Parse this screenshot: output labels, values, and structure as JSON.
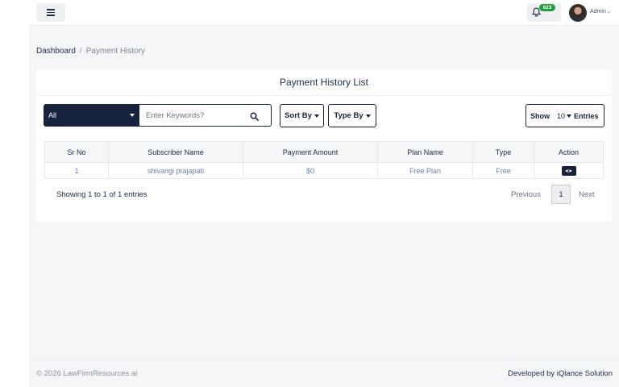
{
  "topbar": {
    "notification_count": "623",
    "user_name": "Admin"
  },
  "breadcrumb": {
    "home": "Dashboard",
    "separator": "/",
    "current": "Payment History"
  },
  "card": {
    "title": "Payment History List"
  },
  "filters": {
    "category_value": "All",
    "search_placeholder": "Enter Keywords?",
    "search_value": "",
    "sort_label": "Sort By",
    "type_label": "Type By",
    "show_label": "Show",
    "entries_value": "10",
    "entries_label": "Entries"
  },
  "table": {
    "columns": [
      "Sr No",
      "Subscriber Name",
      "Payment Amount",
      "Plan Name",
      "Type",
      "Action"
    ],
    "rows": [
      {
        "sr_no": "1",
        "subscriber_name": "shivangi prajapati",
        "payment_amount": "$0",
        "plan_name": "Free Plan",
        "type": "Free"
      }
    ]
  },
  "pagination": {
    "summary": "Showing 1 to 1 of 1 entries",
    "previous": "Previous",
    "current_page": "1",
    "next": "Next"
  },
  "footer": {
    "copyright": "© 2026 LawFirmResources.ai",
    "credit": "Developed by iQlance Solution"
  },
  "colors": {
    "primary_dark": "#17223d",
    "badge_green": "#1f9d3a",
    "page_bg": "#f5f6f8"
  },
  "icons": [
    "menu-icon",
    "bell-icon",
    "search-icon",
    "eye-icon",
    "chevron-down-icon"
  ]
}
